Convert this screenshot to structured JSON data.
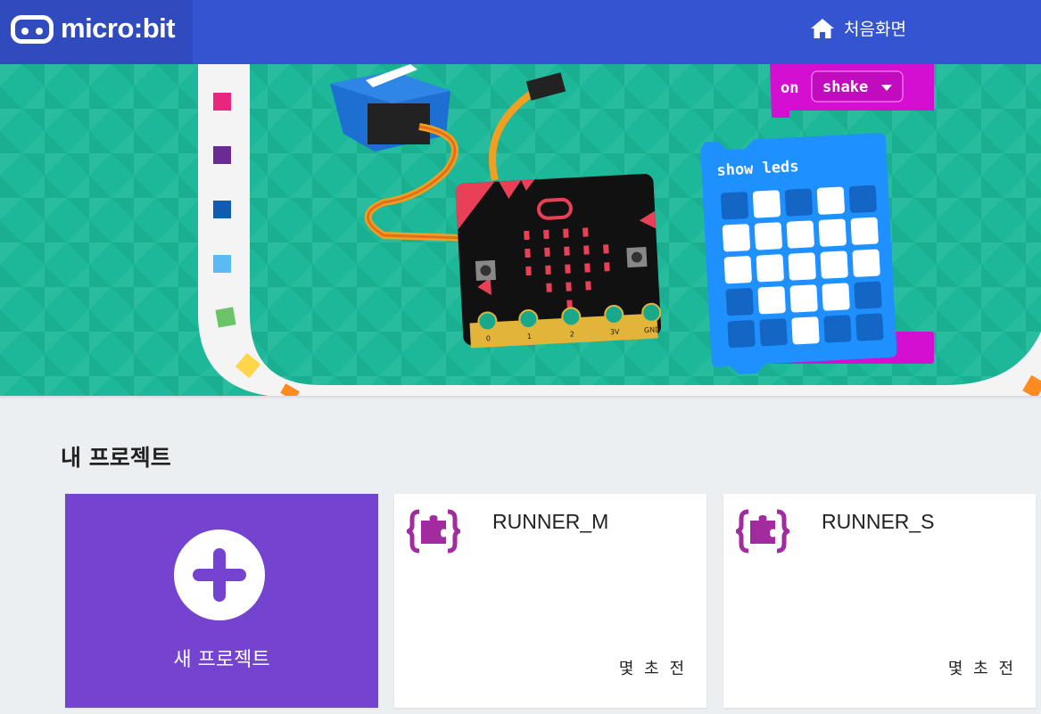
{
  "header": {
    "brand": "micro:bit",
    "home_label": "처음화면",
    "home_icon": "home-icon"
  },
  "hero": {
    "block_event": "on",
    "block_dropdown": "shake",
    "block_show": "show leds",
    "led_grid": [
      [
        0,
        1,
        0,
        1,
        0
      ],
      [
        1,
        1,
        1,
        1,
        1
      ],
      [
        1,
        1,
        1,
        1,
        1
      ],
      [
        0,
        1,
        1,
        1,
        0
      ],
      [
        0,
        0,
        1,
        0,
        0
      ]
    ],
    "pin_labels": [
      "0",
      "1",
      "2",
      "3V",
      "GND"
    ],
    "colors": {
      "hero_bg": "#1cb899",
      "block_magenta": "#d40fd2",
      "block_blue": "#1e90ff",
      "topbar": "#3454d1"
    },
    "palette_colors": [
      "#e8267e",
      "#6a2c91",
      "#0f5cb2",
      "#5bb9f5",
      "#6bc46a",
      "#ffd54a",
      "#ff8a1f"
    ]
  },
  "projects": {
    "section_title": "내 프로젝트",
    "new_project_label": "새 프로젝트",
    "new_project_color": "#7443cf",
    "items": [
      {
        "name": "RUNNER_M",
        "time": "몇 초 전",
        "icon": "project-puzzle-icon"
      },
      {
        "name": "RUNNER_S",
        "time": "몇 초 전",
        "icon": "project-puzzle-icon"
      }
    ]
  }
}
